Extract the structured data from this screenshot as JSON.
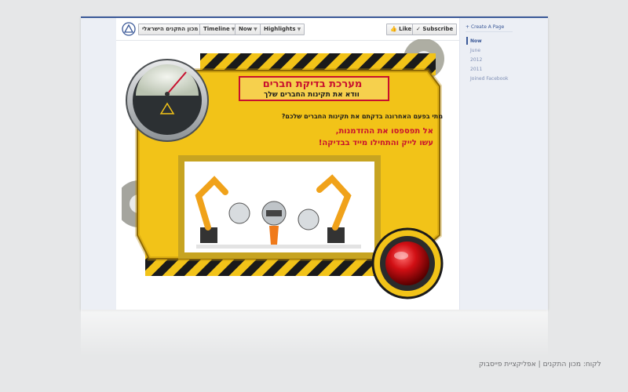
{
  "fb_header": {
    "site_name": "מכון התקנים הישראלי",
    "nav": [
      {
        "label": "Timeline"
      },
      {
        "label": "Now"
      },
      {
        "label": "Highlights"
      }
    ],
    "like_label": "Like",
    "subscribe_label": "Subscribe"
  },
  "right_rail": {
    "create_page": "Create A Page",
    "items": [
      "Now",
      "June",
      "2012",
      "2011",
      "Joined Facebook"
    ]
  },
  "banner": {
    "title": "מערכת בדיקת חברים",
    "subtitle": "וודא את תקינות החברים שלך",
    "question": "מתי בפעם האחרונה בדקתם את תקינות החברים שלכם?",
    "line1": "אל תפספסו את ההזדמנות,",
    "line2": "עשו לייק והתחילו מייד בבדיקה!"
  },
  "caption": "לקוח: מכון התקנים | אפליקציית פייסבוק",
  "colors": {
    "fb_blue": "#3b5998",
    "yellow": "#f2c318",
    "red_text": "#c8102e",
    "button_red": "#d10f14"
  },
  "icons": {
    "gauge": "pressure-gauge-icon",
    "red_button": "red-alarm-button-icon",
    "robots": "robot-arms-illustration"
  }
}
